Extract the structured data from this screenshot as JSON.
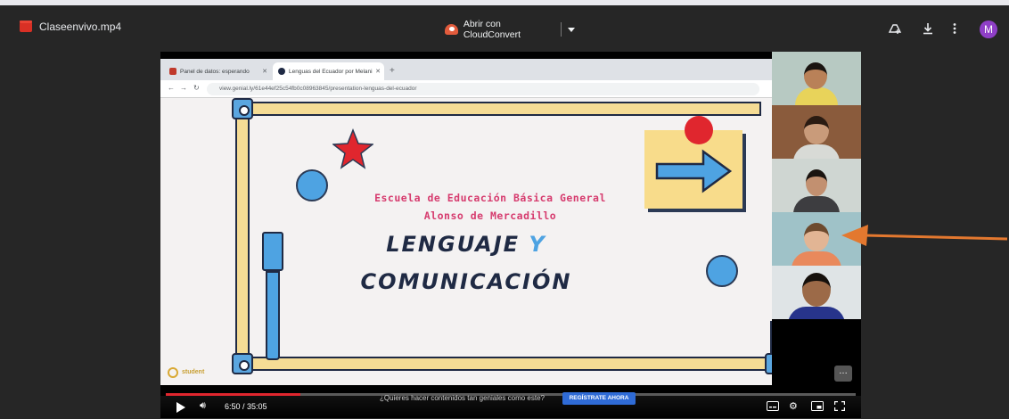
{
  "drive": {
    "file_name": "Claseenvivo.mp4",
    "open_with_label": "Abrir con CloudConvert",
    "icons": [
      "add-to-drive-icon",
      "download-icon",
      "more-vert-icon"
    ],
    "avatar_letter": "M",
    "avatar_color": "#8f3fc7"
  },
  "browser": {
    "tabs": [
      {
        "label": "Panel de datos: esperando"
      },
      {
        "label": "Lenguas del Ecuador por Melani"
      }
    ],
    "url": "view.genial.ly/61e44ef25c54fb0c08963845/presentation-lenguas-del-ecuador"
  },
  "slide": {
    "school_line1": "Escuela de Educación Básica General",
    "school_line2": "Alonso de Mercadillo",
    "title_part1": "LENGUAJE",
    "title_y": "Y",
    "title_part2": "COMUNICACIÓN",
    "brand": "student",
    "accent_blue": "#4ea3e2",
    "accent_yellow": "#f5dc95",
    "accent_red": "#e0262e"
  },
  "player": {
    "time": "6:50 / 35:05",
    "progress_fraction": 0.195,
    "promo_text": "¿Quieres hacer contenidos tan geniales como este?",
    "cta_label": "REGÍSTRATE AHORA"
  }
}
